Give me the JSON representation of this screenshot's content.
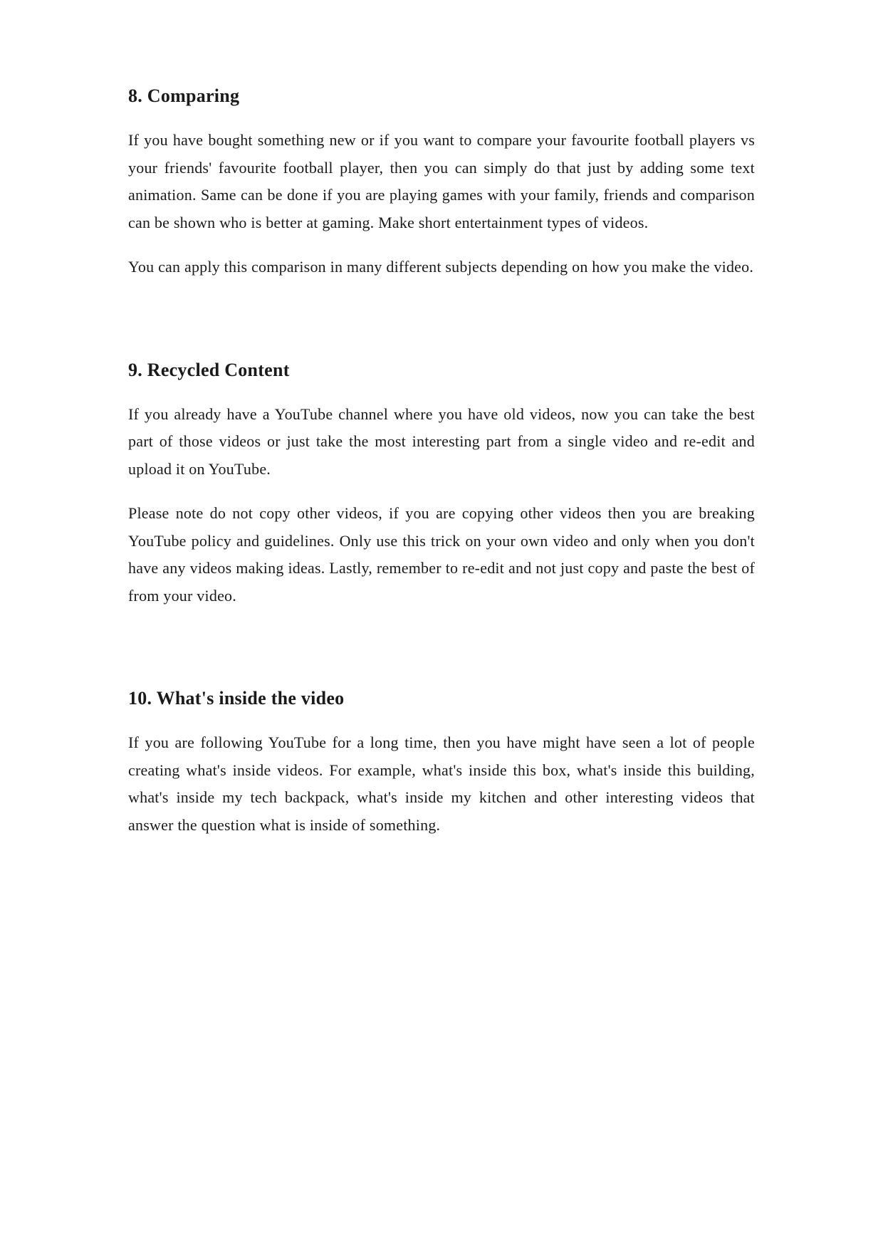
{
  "sections": [
    {
      "id": "comparing",
      "heading": "8. Comparing",
      "paragraphs": [
        "If you have bought something new or if you want to compare your favourite football players vs your friends' favourite football player, then you can simply do that just by adding some text animation. Same can be done if you are playing games with your family, friends and comparison can be shown who is better at gaming. Make short entertainment types of videos.",
        "You can apply this comparison in many different subjects depending on how you make the video."
      ]
    },
    {
      "id": "recycled-content",
      "heading": "9. Recycled Content",
      "paragraphs": [
        "If you already have a YouTube channel where you have old videos, now you can take the best part of those videos or just take the most interesting part from a single video and re-edit and upload it on YouTube.",
        "Please note do not copy other videos, if you are copying other videos then you are breaking YouTube policy and guidelines. Only use this trick on your own video and only when you don't have any videos making ideas. Lastly, remember to re-edit and not just copy and paste the best of from your video."
      ]
    },
    {
      "id": "whats-inside",
      "heading": "10. What's inside the video",
      "paragraphs": [
        "If you are following YouTube for a long time, then you have might have seen a lot of people creating what's inside videos. For example, what's inside this box, what's inside this building, what's inside my tech backpack, what's inside my kitchen and other interesting videos that answer the question what is inside of something."
      ]
    }
  ]
}
